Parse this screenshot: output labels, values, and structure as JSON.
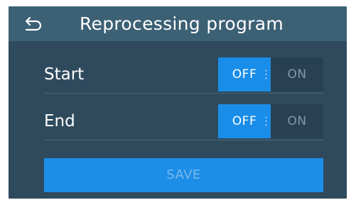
{
  "header": {
    "title": "Reprocessing program",
    "back_icon": "back-arrow-icon"
  },
  "rows": [
    {
      "label": "Start",
      "toggle": {
        "off_label": "OFF",
        "on_label": "ON",
        "selected": "OFF"
      }
    },
    {
      "label": "End",
      "toggle": {
        "off_label": "OFF",
        "on_label": "ON",
        "selected": "OFF"
      }
    }
  ],
  "save": {
    "label": "SAVE",
    "enabled": false
  },
  "colors": {
    "background": "#2f4a5d",
    "header": "#3c6074",
    "accent": "#1a8de9",
    "text": "#ffffff",
    "inactive_text": "#8396a4"
  }
}
